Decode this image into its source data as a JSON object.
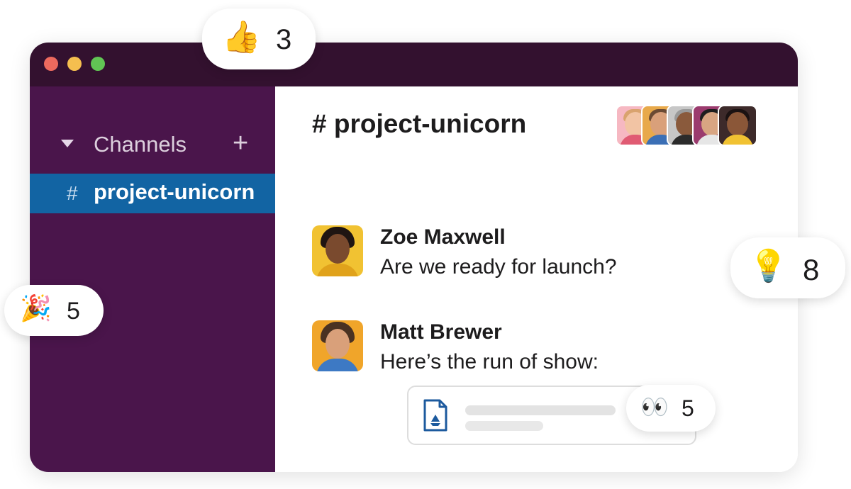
{
  "window": {
    "controls": [
      "close",
      "minimize",
      "maximize"
    ],
    "colors": {
      "titlebar": "#33112f",
      "sidebar": "#4a154b",
      "active_channel": "#1264a3",
      "close": "#ed6a5e",
      "minimize": "#f5bf4f",
      "maximize": "#61c554"
    }
  },
  "sidebar": {
    "section_label": "Channels",
    "add_symbol": "+",
    "active_channel": {
      "hash": "#",
      "name": "project-unicorn"
    }
  },
  "channel": {
    "title": "# project-unicorn",
    "member_count_shown": 5
  },
  "messages": [
    {
      "sender": "Zoe Maxwell",
      "text": "Are we ready for launch?"
    },
    {
      "sender": "Matt Brewer",
      "text": "Here’s the run of show:"
    }
  ],
  "attachment": {
    "icon": "google-drive-file-icon"
  },
  "reactions": [
    {
      "name": "thumbs-up",
      "emoji": "👍",
      "count": "3"
    },
    {
      "name": "light-bulb",
      "emoji": "💡",
      "count": "8"
    },
    {
      "name": "party-popper",
      "emoji": "🎉",
      "count": "5"
    },
    {
      "name": "eyes",
      "emoji": "👀",
      "count": "5"
    }
  ]
}
